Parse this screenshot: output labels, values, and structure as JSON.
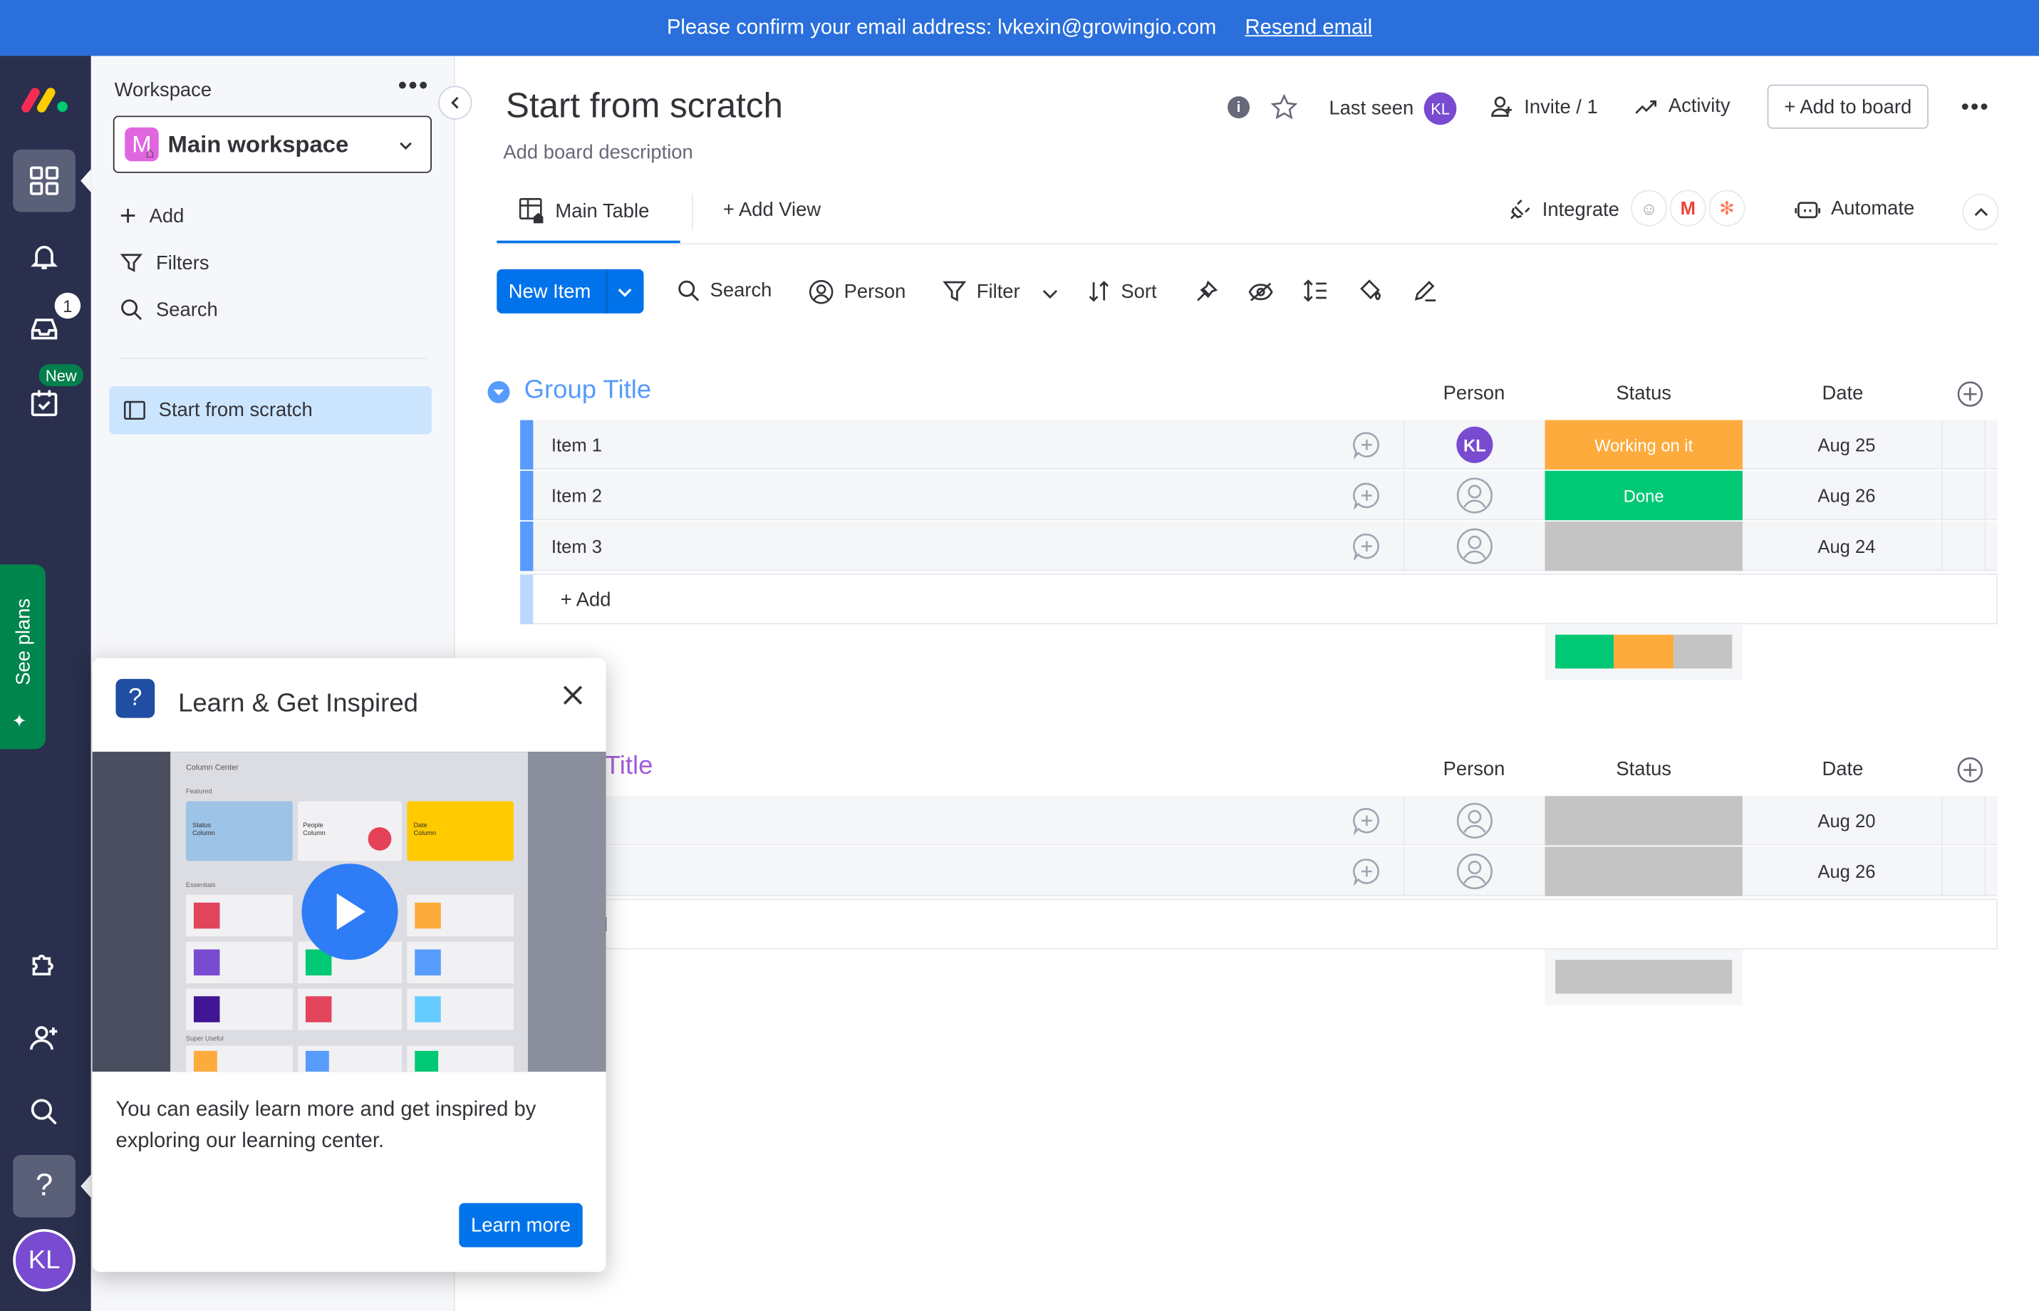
{
  "banner": {
    "message": "Please confirm your email address: lvkexin@growingio.com",
    "link": "Resend email"
  },
  "rail": {
    "inbox_badge": "1",
    "new_badge": "New",
    "see_plans": "See plans",
    "avatar_initials": "KL"
  },
  "workspace": {
    "label": "Workspace",
    "selector_initial": "M",
    "selector_name": "Main workspace",
    "add": "Add",
    "filters": "Filters",
    "search": "Search",
    "boards": [
      {
        "name": "Start from scratch"
      }
    ]
  },
  "board": {
    "title": "Start from scratch",
    "description": "Add board description",
    "last_seen": "Last seen",
    "user_initials": "KL",
    "invite": "Invite / 1",
    "activity": "Activity",
    "add_to_board": "+ Add to board",
    "tabs": {
      "main_table": "Main Table",
      "add_view": "+ Add View",
      "integrate": "Integrate",
      "automate": "Automate"
    },
    "toolbar": {
      "new_item": "New Item",
      "search": "Search",
      "person": "Person",
      "filter": "Filter",
      "sort": "Sort"
    }
  },
  "columns": {
    "person": "Person",
    "status": "Status",
    "date": "Date"
  },
  "groups": [
    {
      "title": "Group Title",
      "color": "#579bfc",
      "add_label": "+ Add",
      "items": [
        {
          "name": "Item 1",
          "person": "KL",
          "status": "Working on it",
          "status_color": "#fdab3d",
          "date": "Aug 25"
        },
        {
          "name": "Item 2",
          "person": "",
          "status": "Done",
          "status_color": "#00c875",
          "date": "Aug 26"
        },
        {
          "name": "Item 3",
          "person": "",
          "status": "",
          "status_color": "#c4c4c4",
          "date": "Aug 24"
        }
      ],
      "summary": [
        {
          "color": "#00c875",
          "fraction": 0.333
        },
        {
          "color": "#fdab3d",
          "fraction": 0.333
        },
        {
          "color": "#c4c4c4",
          "fraction": 0.334
        }
      ]
    },
    {
      "title": "Title",
      "color": "#a25ddc",
      "add_label": "d",
      "items": [
        {
          "name": "",
          "person": "",
          "status": "",
          "status_color": "#c4c4c4",
          "date": "Aug 20"
        },
        {
          "name": "",
          "person": "",
          "status": "",
          "status_color": "#c4c4c4",
          "date": "Aug 26"
        }
      ],
      "summary": [
        {
          "color": "#c4c4c4",
          "fraction": 1
        }
      ]
    }
  ],
  "popup": {
    "title": "Learn & Get Inspired",
    "body": "You can easily learn more and get inspired by exploring our learning center.",
    "button": "Learn more",
    "video": {
      "header": "Column Center",
      "featured": "Featured",
      "essentials": "Essentials",
      "super_useful": "Super Useful",
      "status_column": "Status Column",
      "people_column": "People Column",
      "date_column": "Date Column"
    }
  }
}
